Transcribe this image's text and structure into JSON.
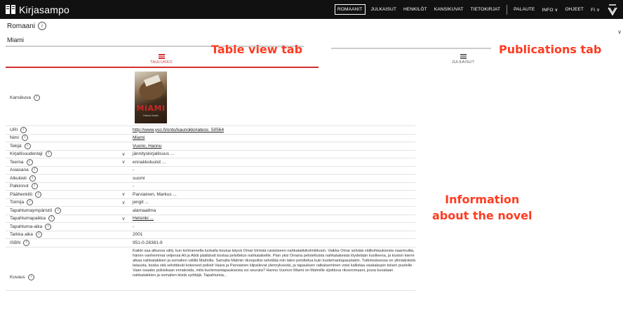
{
  "app": {
    "title": "Kirjasampo"
  },
  "nav": {
    "items": [
      "ROMAANIT",
      "JULKAISUT",
      "HENKILÖT",
      "KANSIKUVAT",
      "TIETOKIRJAT"
    ],
    "secondary": [
      "PALAUTE",
      "INFO ∨",
      "OHJEET",
      "FI ∨"
    ]
  },
  "page": {
    "title": "Romaani",
    "subtitle": "Miami"
  },
  "tabs": {
    "table": "TAULUKKO",
    "publications": "JULKAISUT"
  },
  "annotations": {
    "table_tab": "Table view tab",
    "publications_tab": "Publications tab",
    "info_line1": "Information",
    "info_line2": "about the novel"
  },
  "cover": {
    "label": "Kansikuva",
    "title": "MIAMI",
    "subtitle": "Hannu Vuorio"
  },
  "rows": [
    {
      "label": "URI",
      "value": "http://www.yso.fi/onto/kaunokki#ateos_50564",
      "link": true,
      "expand": false
    },
    {
      "label": "Nimi",
      "value": "Miami",
      "link": true,
      "expand": false
    },
    {
      "label": "Tekijä",
      "value": "Vuorio, Hannu",
      "link": true,
      "expand": false
    },
    {
      "label": "Kirjallisuudenlaji",
      "value": "jännityskirjallisuus ...",
      "link": false,
      "expand": true
    },
    {
      "label": "Teema",
      "value": "ennakkoluulot ...",
      "link": false,
      "expand": true
    },
    {
      "label": "Asiasana",
      "value": "-",
      "link": false,
      "expand": false
    },
    {
      "label": "Alkukieli",
      "value": "suomi",
      "link": false,
      "expand": false
    },
    {
      "label": "Palkinnot",
      "value": "-",
      "link": false,
      "expand": false
    },
    {
      "label": "Päähenkilö",
      "value": "Parviainen, Markus ...",
      "link": false,
      "expand": true
    },
    {
      "label": "Toimija",
      "value": "jengit ...",
      "link": false,
      "expand": true
    },
    {
      "label": "Tapahtumaympäristö",
      "value": "alamaailma",
      "link": false,
      "expand": false
    },
    {
      "label": "Tapahtumapaikka",
      "value": "Helsinki ...",
      "link": true,
      "expand": true
    },
    {
      "label": "Tapahtuma-aika",
      "value": "-",
      "link": false,
      "expand": false
    },
    {
      "label": "Tarkka aika",
      "value": "2001",
      "link": false,
      "expand": false
    },
    {
      "label": "ISBN",
      "value": "951-0-28381-9",
      "link": false,
      "expand": false
    }
  ],
  "description": {
    "label": "Kuvaus",
    "text": "Kaikki saa alkunsa siitä, kun kolmannella luokalla koulua käyvä Omar törmää rasistiseen nahkatakkikolmikkoon. Vaikka Omar selviää välikohtauksesta naarmuitta, hänen vanhemmat veljensä Ali ja Abdi päättävät kostaa pelottelun nahkatakeille. Pian yksi Omaria pelotelluista nahkatakeista löydetään kuolleena, ja koston kierre alkaa nahkatakkien ja somalien välillä Malmilla. Samalla Malmin rikospoliisi selvittää niin laten pelottelua kuin kuolemantapaustakin. Tutkimuksessa on ylimääräistä latausta, koska sitä selvittävät kokeneet poliisit Vaara ja Parviainen kilpailevat ylennyksestä, ja tapauksen ratkaiseminen voisi kallistaa vaakakupin toisen puolelle. Vaan osaako poliisikaan ennakoida, mitä kuolemantapauksesta voi seurata? Hannu Vuorion Miami on Malmille sijoittuva rikosromaani, jossa kuvataan nahkatakkien ja somalien kiistä syöttäjä. Tapahtumia..."
  }
}
